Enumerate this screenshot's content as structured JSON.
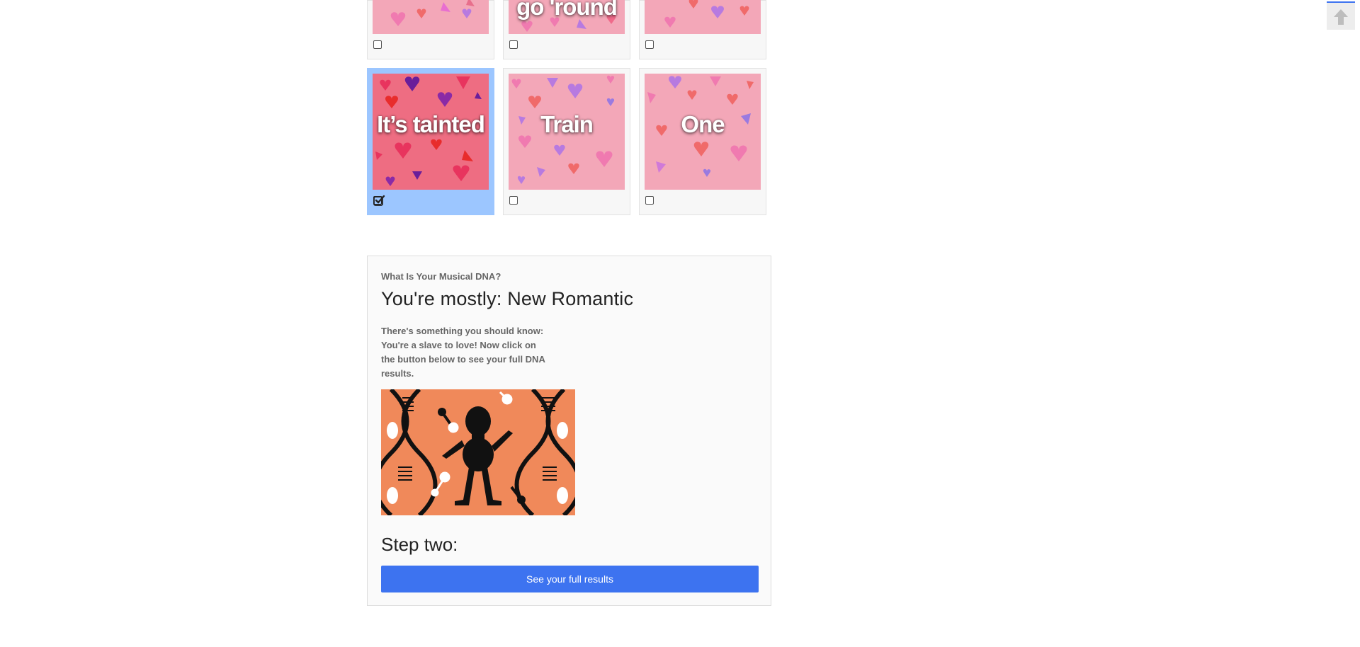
{
  "quiz_grid": {
    "row1": [
      {
        "caption": "",
        "checked": false
      },
      {
        "caption": "go 'round",
        "checked": false
      },
      {
        "caption": "",
        "checked": false
      }
    ],
    "row2": [
      {
        "caption": "It’s tainted",
        "checked": true
      },
      {
        "caption": "Train",
        "checked": false
      },
      {
        "caption": "One",
        "checked": false
      }
    ]
  },
  "result": {
    "quiz_name": "What Is Your Musical DNA?",
    "headline": "You're mostly: New Romantic",
    "description": "There's something you should know: You're a slave to love! Now click on the button below to see your full DNA results.",
    "step_label": "Step two:",
    "cta_label": "See your full results"
  },
  "back_to_top": {
    "icon": "arrow-up-icon"
  },
  "colors": {
    "accent": "#3d73f0",
    "selected_tile": "#9cc6ff",
    "dna_background": "#f0895a"
  }
}
